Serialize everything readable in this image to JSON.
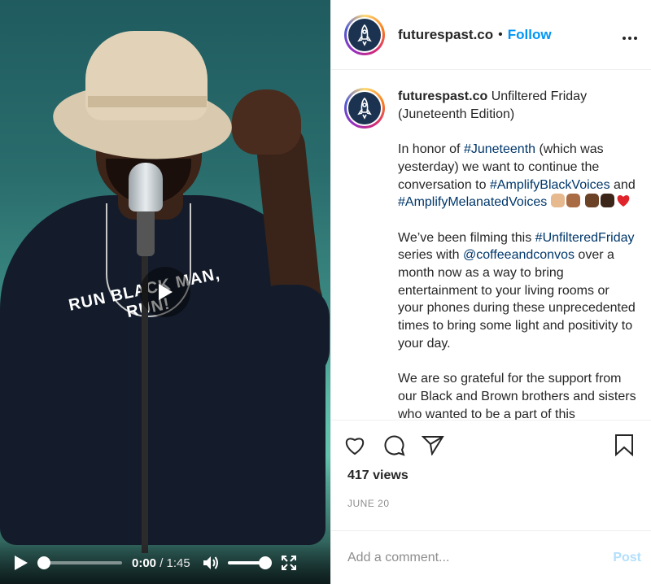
{
  "header": {
    "username": "futurespast.co",
    "separator": "•",
    "follow_label": "Follow",
    "more_label": "•••"
  },
  "caption": {
    "username": "futurespast.co",
    "title": "Unfiltered Friday (Juneteenth Edition)",
    "p1_pre": "In honor of ",
    "p1_tag1": "#Juneteenth",
    "p1_mid": " (which was yesterday) we want to continue the conversation to ",
    "p1_tag2": "#AmplifyBlackVoices",
    "p1_and": " and ",
    "p1_tag3": "#AmplifyMelanatedVoices",
    "p2_pre": "We’ve been filming this ",
    "p2_tag": "#UnfilteredFriday",
    "p2_mid": " series with ",
    "p2_mention": "@coffeeandconvos",
    "p2_post": " over a month now as a way to bring entertainment to your living rooms or your phones during these unprecedented times to bring some light and positivity to your day.",
    "p3": "We are so grateful for the support from our Black and Brown brothers and sisters who wanted to be a part of this"
  },
  "video": {
    "shirt_text": "RUN BLACK MAN, RUN!",
    "current_time": "0:00",
    "time_sep": " / ",
    "duration": "1:45",
    "progress": 0,
    "volume": 1
  },
  "stats": {
    "views": "417 views",
    "date": "JUNE 20"
  },
  "comment": {
    "placeholder": "Add a comment...",
    "post_label": "Post"
  },
  "colors": {
    "link": "#0095f6",
    "hashtag": "#00376b",
    "post_disabled": "#b2dffc",
    "muted": "#8e8e8e"
  },
  "icons": [
    "play-icon",
    "volume-icon",
    "fullscreen-icon",
    "heart-icon",
    "comment-icon",
    "share-icon",
    "bookmark-icon",
    "more-icon",
    "rocket-logo-icon"
  ]
}
